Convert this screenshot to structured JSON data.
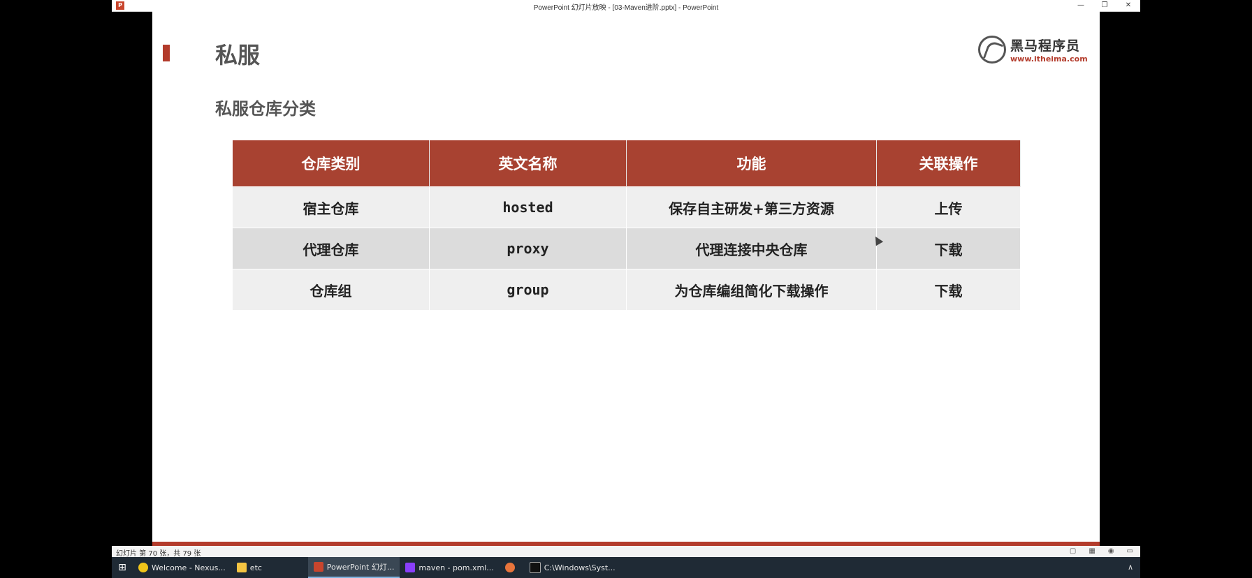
{
  "window": {
    "title": "PowerPoint 幻灯片放映 - [03-Maven进阶.pptx] - PowerPoint",
    "app_icon": "P",
    "buttons": [
      "—",
      "❐",
      "✕"
    ]
  },
  "slide": {
    "title": "私服",
    "subtitle": "私服仓库分类",
    "logo": {
      "cn": "黑马程序员",
      "url": "www.itheima.com"
    },
    "table": {
      "headers": [
        "仓库类别",
        "英文名称",
        "功能",
        "关联操作"
      ],
      "rows": [
        [
          "宿主仓库",
          "hosted",
          "保存自主研发+第三方资源",
          "上传"
        ],
        [
          "代理仓库",
          "proxy",
          "代理连接中央仓库",
          "下载"
        ],
        [
          "仓库组",
          "group",
          "为仓库编组简化下载操作",
          "下载"
        ]
      ]
    }
  },
  "statusbar": {
    "text": "幻灯片 第 70 张，共 79 张"
  },
  "taskbar": {
    "items": [
      {
        "label": "Welcome - Nexus...",
        "color": "#f0c419"
      },
      {
        "label": "etc",
        "color": "#f5c542"
      },
      {
        "label": "PowerPoint 幻灯...",
        "color": "#c8452d"
      },
      {
        "label": "maven - pom.xml...",
        "color": "#8a3ffc"
      },
      {
        "label": "",
        "color": "#e8743b"
      },
      {
        "label": "C:\\Windows\\Syst...",
        "color": "#111111"
      }
    ]
  },
  "colors": {
    "accent": "#b33b2b",
    "header_bg": "#a84231"
  }
}
